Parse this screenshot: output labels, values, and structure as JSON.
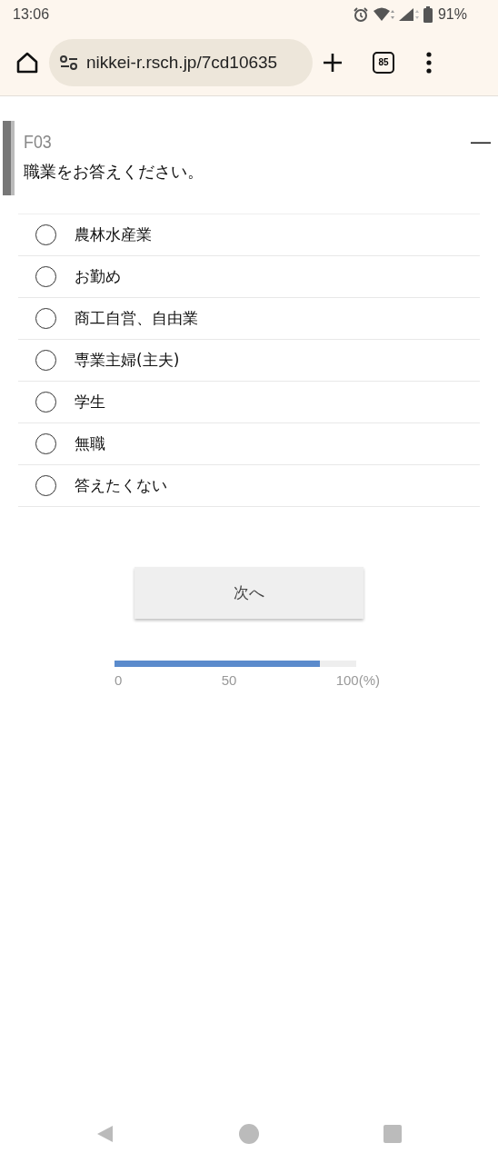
{
  "status_bar": {
    "time": "13:06",
    "battery": "91%"
  },
  "browser": {
    "url": "nikkei-r.rsch.jp/7cd10635",
    "tab_count": "85"
  },
  "question": {
    "code": "F03",
    "collapse": "—",
    "text": "職業をお答えください。",
    "options": [
      {
        "label": "農林水産業",
        "selected": false
      },
      {
        "label": "お勤め",
        "selected": false
      },
      {
        "label": "商工自営、自由業",
        "selected": false
      },
      {
        "label": "専業主婦(主夫)",
        "selected": false
      },
      {
        "label": "学生",
        "selected": false
      },
      {
        "label": "無職",
        "selected": false
      },
      {
        "label": "答えたくない",
        "selected": false
      }
    ]
  },
  "next_button": "次へ",
  "progress": {
    "level": 0.85,
    "ticks": [
      "0",
      "50",
      "100(%)"
    ]
  }
}
